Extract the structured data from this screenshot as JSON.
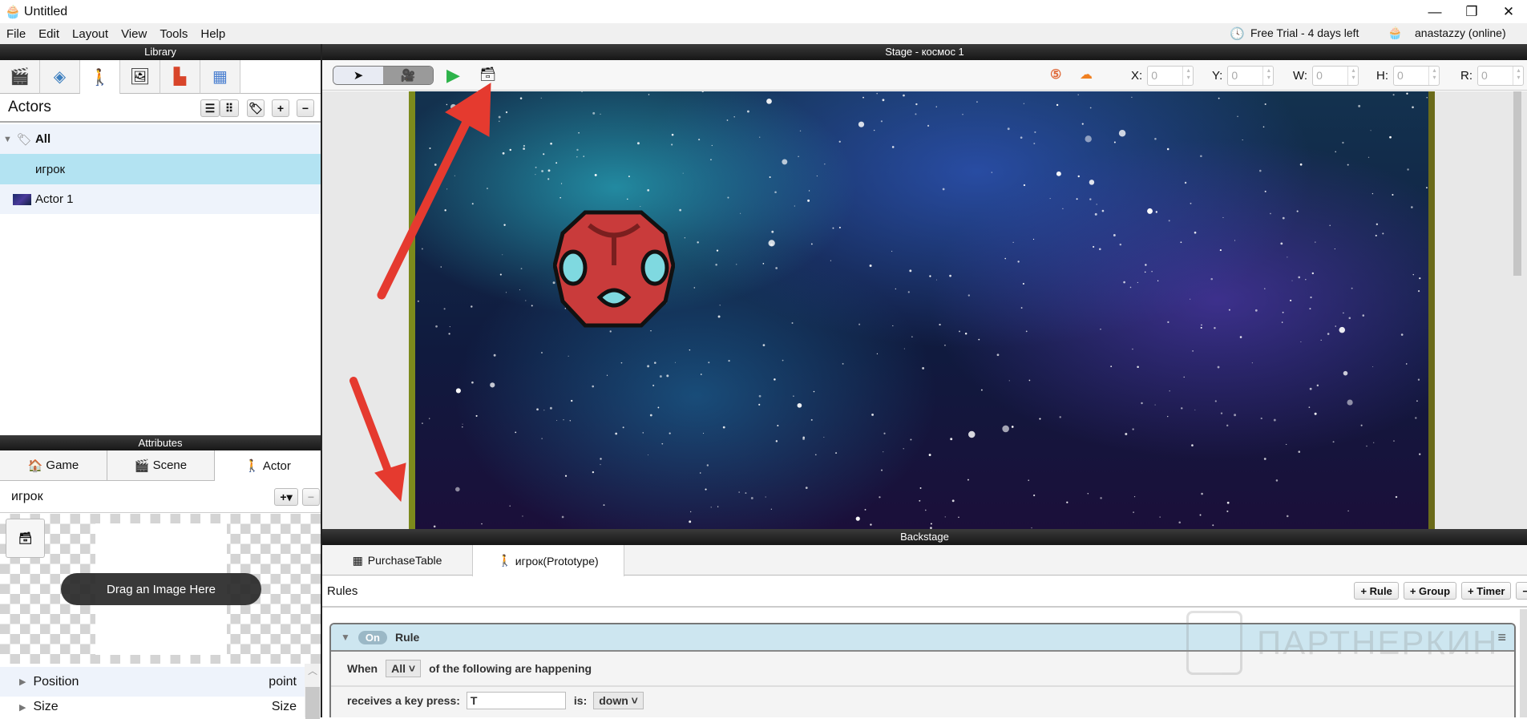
{
  "window": {
    "title": "Untitled",
    "minimize": "—",
    "maximize": "❐",
    "close": "✕"
  },
  "menu": [
    "File",
    "Edit",
    "Layout",
    "View",
    "Tools",
    "Help"
  ],
  "status": {
    "trial": "Free Trial - 4 days left",
    "user": "anastazzy (online)"
  },
  "library": {
    "header": "Library",
    "section_title": "Actors",
    "tree": {
      "group": "All",
      "items": [
        "игрок",
        "Actor 1"
      ]
    }
  },
  "attributes": {
    "header": "Attributes",
    "tabs": [
      "Game",
      "Scene",
      "Actor"
    ],
    "actor_name": "игрок",
    "drop_hint": "Drag an Image Here",
    "props": [
      {
        "name": "Position",
        "value": "point"
      },
      {
        "name": "Size",
        "value": "Size"
      }
    ]
  },
  "stage": {
    "header": "Stage - космос 1",
    "fields": [
      {
        "label": "X:",
        "value": "0"
      },
      {
        "label": "Y:",
        "value": "0"
      },
      {
        "label": "W:",
        "value": "0"
      },
      {
        "label": "H:",
        "value": "0"
      },
      {
        "label": "R:",
        "value": "0"
      }
    ]
  },
  "backstage": {
    "header": "Backstage",
    "tabs": [
      "PurchaseTable",
      "игрок(Prototype)"
    ],
    "rules_label": "Rules",
    "buttons": [
      "+ Rule",
      "+ Group",
      "+ Timer"
    ],
    "rule": {
      "toggle": "On",
      "title": "Rule",
      "when": "When",
      "mode": "All",
      "following": "of the following are happening",
      "cond_label": "receives a key press:",
      "key": "T",
      "is_label": "is:",
      "state": "down"
    }
  },
  "watermark": "ПАРТНЕРКИН",
  "colors": {
    "selected_row": "#b3e3f2",
    "rule_header": "#cde6f0",
    "arrow": "#e53a2f"
  }
}
